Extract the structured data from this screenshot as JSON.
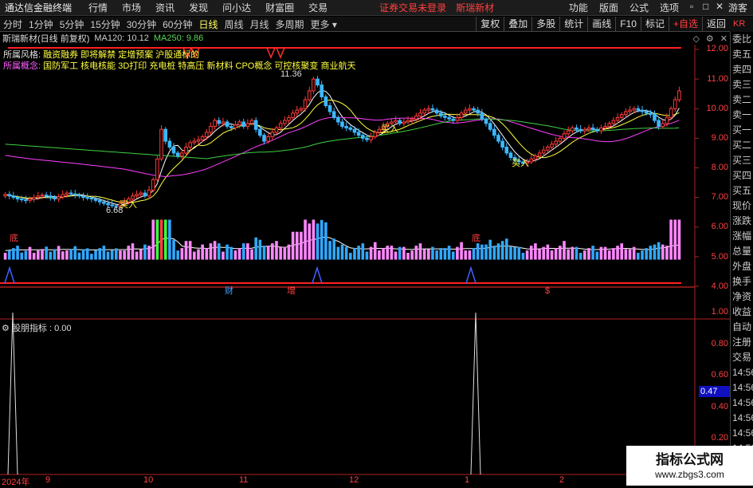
{
  "menubar": {
    "app_title": "通达信金融终端",
    "items": [
      "行情",
      "市场",
      "资讯",
      "发现",
      "问小达",
      "财富圈",
      "交易"
    ],
    "warning": "证券交易未登录",
    "stock_name": "斯瑞新材",
    "right_items": [
      "功能",
      "版面",
      "公式",
      "选项"
    ],
    "user": "游客"
  },
  "periods": [
    {
      "label": "分时",
      "active": false
    },
    {
      "label": "1分钟",
      "active": false
    },
    {
      "label": "5分钟",
      "active": false
    },
    {
      "label": "15分钟",
      "active": false
    },
    {
      "label": "30分钟",
      "active": false
    },
    {
      "label": "60分钟",
      "active": false
    },
    {
      "label": "日线",
      "active": true
    },
    {
      "label": "周线",
      "active": false
    },
    {
      "label": "月线",
      "active": false
    },
    {
      "label": "多周期",
      "active": false
    },
    {
      "label": "更多",
      "active": false
    }
  ],
  "toolbar_right": [
    "复权",
    "叠加",
    "多股",
    "统计",
    "画线",
    "F10",
    "标记",
    "+自选",
    "返回"
  ],
  "kr_label": "KR",
  "info": {
    "name": "斯瑞新材(日线 前复权)",
    "ma120": "MA120: 10.12",
    "ma250": "MA250: 9.86"
  },
  "style_line": {
    "label": "所属风格:",
    "value": "融资融券 即将解禁 定增预案 沪股通标的"
  },
  "concept_line": {
    "label": "所属概念:",
    "value": "国防军工 核电核能 3D打印 充电桩 特高压 新材料 CPO概念 可控核聚变 商业航天"
  },
  "annotations": {
    "low_price": "6.68",
    "high_price": "11.36",
    "buy_signal_1": "买入",
    "buy_signal_2": "买入",
    "buy_signal_3": "买入",
    "bottom_1": "底",
    "bottom_2": "底",
    "mark_cai": "财",
    "mark_zeng": "增",
    "mark_s": "$"
  },
  "price_axis": [
    "12.00",
    "11.00",
    "10.00",
    "9.00",
    "8.00",
    "7.00",
    "6.00",
    "5.00",
    "4.00"
  ],
  "indicator": {
    "title": "股朋指标 : 0.00",
    "axis": [
      "1.00",
      "0.80",
      "0.60",
      "0.40",
      "0.20"
    ],
    "current": "0.47"
  },
  "x_axis": [
    "2024年",
    "9",
    "10",
    "11",
    "12",
    "1",
    "2"
  ],
  "side_panel": [
    "委比",
    "卖五",
    "卖四",
    "卖三",
    "卖二",
    "卖一",
    "买一",
    "买二",
    "买三",
    "买四",
    "买五",
    "现价",
    "涨跌",
    "涨幅",
    "总量",
    "外盘",
    "换手",
    "净资",
    "收益",
    "自动",
    "注册",
    "交易",
    "14:56",
    "14:56",
    "14:56",
    "14:56",
    "14:56",
    "14:56",
    "14:56",
    "14:56"
  ],
  "watermark": {
    "title": "指标公式网",
    "url": "www.zbgs3.com"
  },
  "chart_data": {
    "type": "candlestick",
    "ylim": [
      3.9,
      12.3
    ],
    "closes": [
      7.1,
      7.05,
      7.0,
      6.95,
      6.92,
      6.9,
      6.95,
      7.0,
      7.05,
      7.08,
      7.05,
      7.0,
      6.95,
      7.02,
      7.1,
      7.15,
      7.12,
      7.08,
      7.05,
      7.0,
      6.98,
      6.95,
      6.9,
      6.85,
      6.8,
      6.75,
      6.72,
      6.7,
      6.8,
      6.85,
      6.95,
      7.05,
      7.1,
      7.15,
      7.05,
      7.25,
      7.6,
      8.3,
      9.3,
      8.9,
      8.7,
      8.5,
      8.4,
      8.5,
      8.7,
      8.85,
      8.9,
      8.95,
      9.05,
      9.2,
      9.4,
      9.6,
      9.5,
      9.55,
      9.4,
      9.35,
      9.45,
      9.55,
      9.4,
      9.5,
      9.6,
      9.3,
      9.1,
      8.9,
      9.05,
      9.2,
      9.35,
      9.5,
      9.6,
      9.7,
      9.85,
      9.95,
      10.0,
      10.3,
      10.6,
      11.0,
      10.8,
      10.4,
      10.1,
      9.9,
      9.7,
      9.55,
      9.4,
      9.35,
      9.3,
      9.2,
      9.1,
      9.0,
      8.95,
      9.05,
      9.2,
      9.3,
      9.4,
      9.5,
      9.55,
      9.6,
      9.5,
      9.55,
      9.6,
      9.65,
      9.75,
      9.85,
      9.95,
      10.0,
      9.95,
      9.85,
      9.75,
      9.7,
      9.65,
      9.6,
      9.7,
      9.85,
      9.95,
      10.0,
      9.95,
      9.85,
      9.65,
      9.5,
      9.3,
      9.1,
      8.9,
      8.7,
      8.5,
      8.35,
      8.25,
      8.2,
      8.15,
      8.2,
      8.3,
      8.4,
      8.5,
      8.6,
      8.7,
      8.8,
      8.9,
      9.0,
      9.15,
      9.25,
      9.35,
      9.3,
      9.25,
      9.3,
      9.35,
      9.3,
      9.25,
      9.35,
      9.4,
      9.5,
      9.6,
      9.7,
      9.8,
      9.9,
      9.95,
      10.0,
      9.95,
      9.9,
      9.85,
      9.8,
      9.6,
      9.4,
      9.5,
      9.7,
      10.0,
      10.3,
      10.6
    ],
    "volume_range": [
      4.4,
      6.4
    ]
  }
}
